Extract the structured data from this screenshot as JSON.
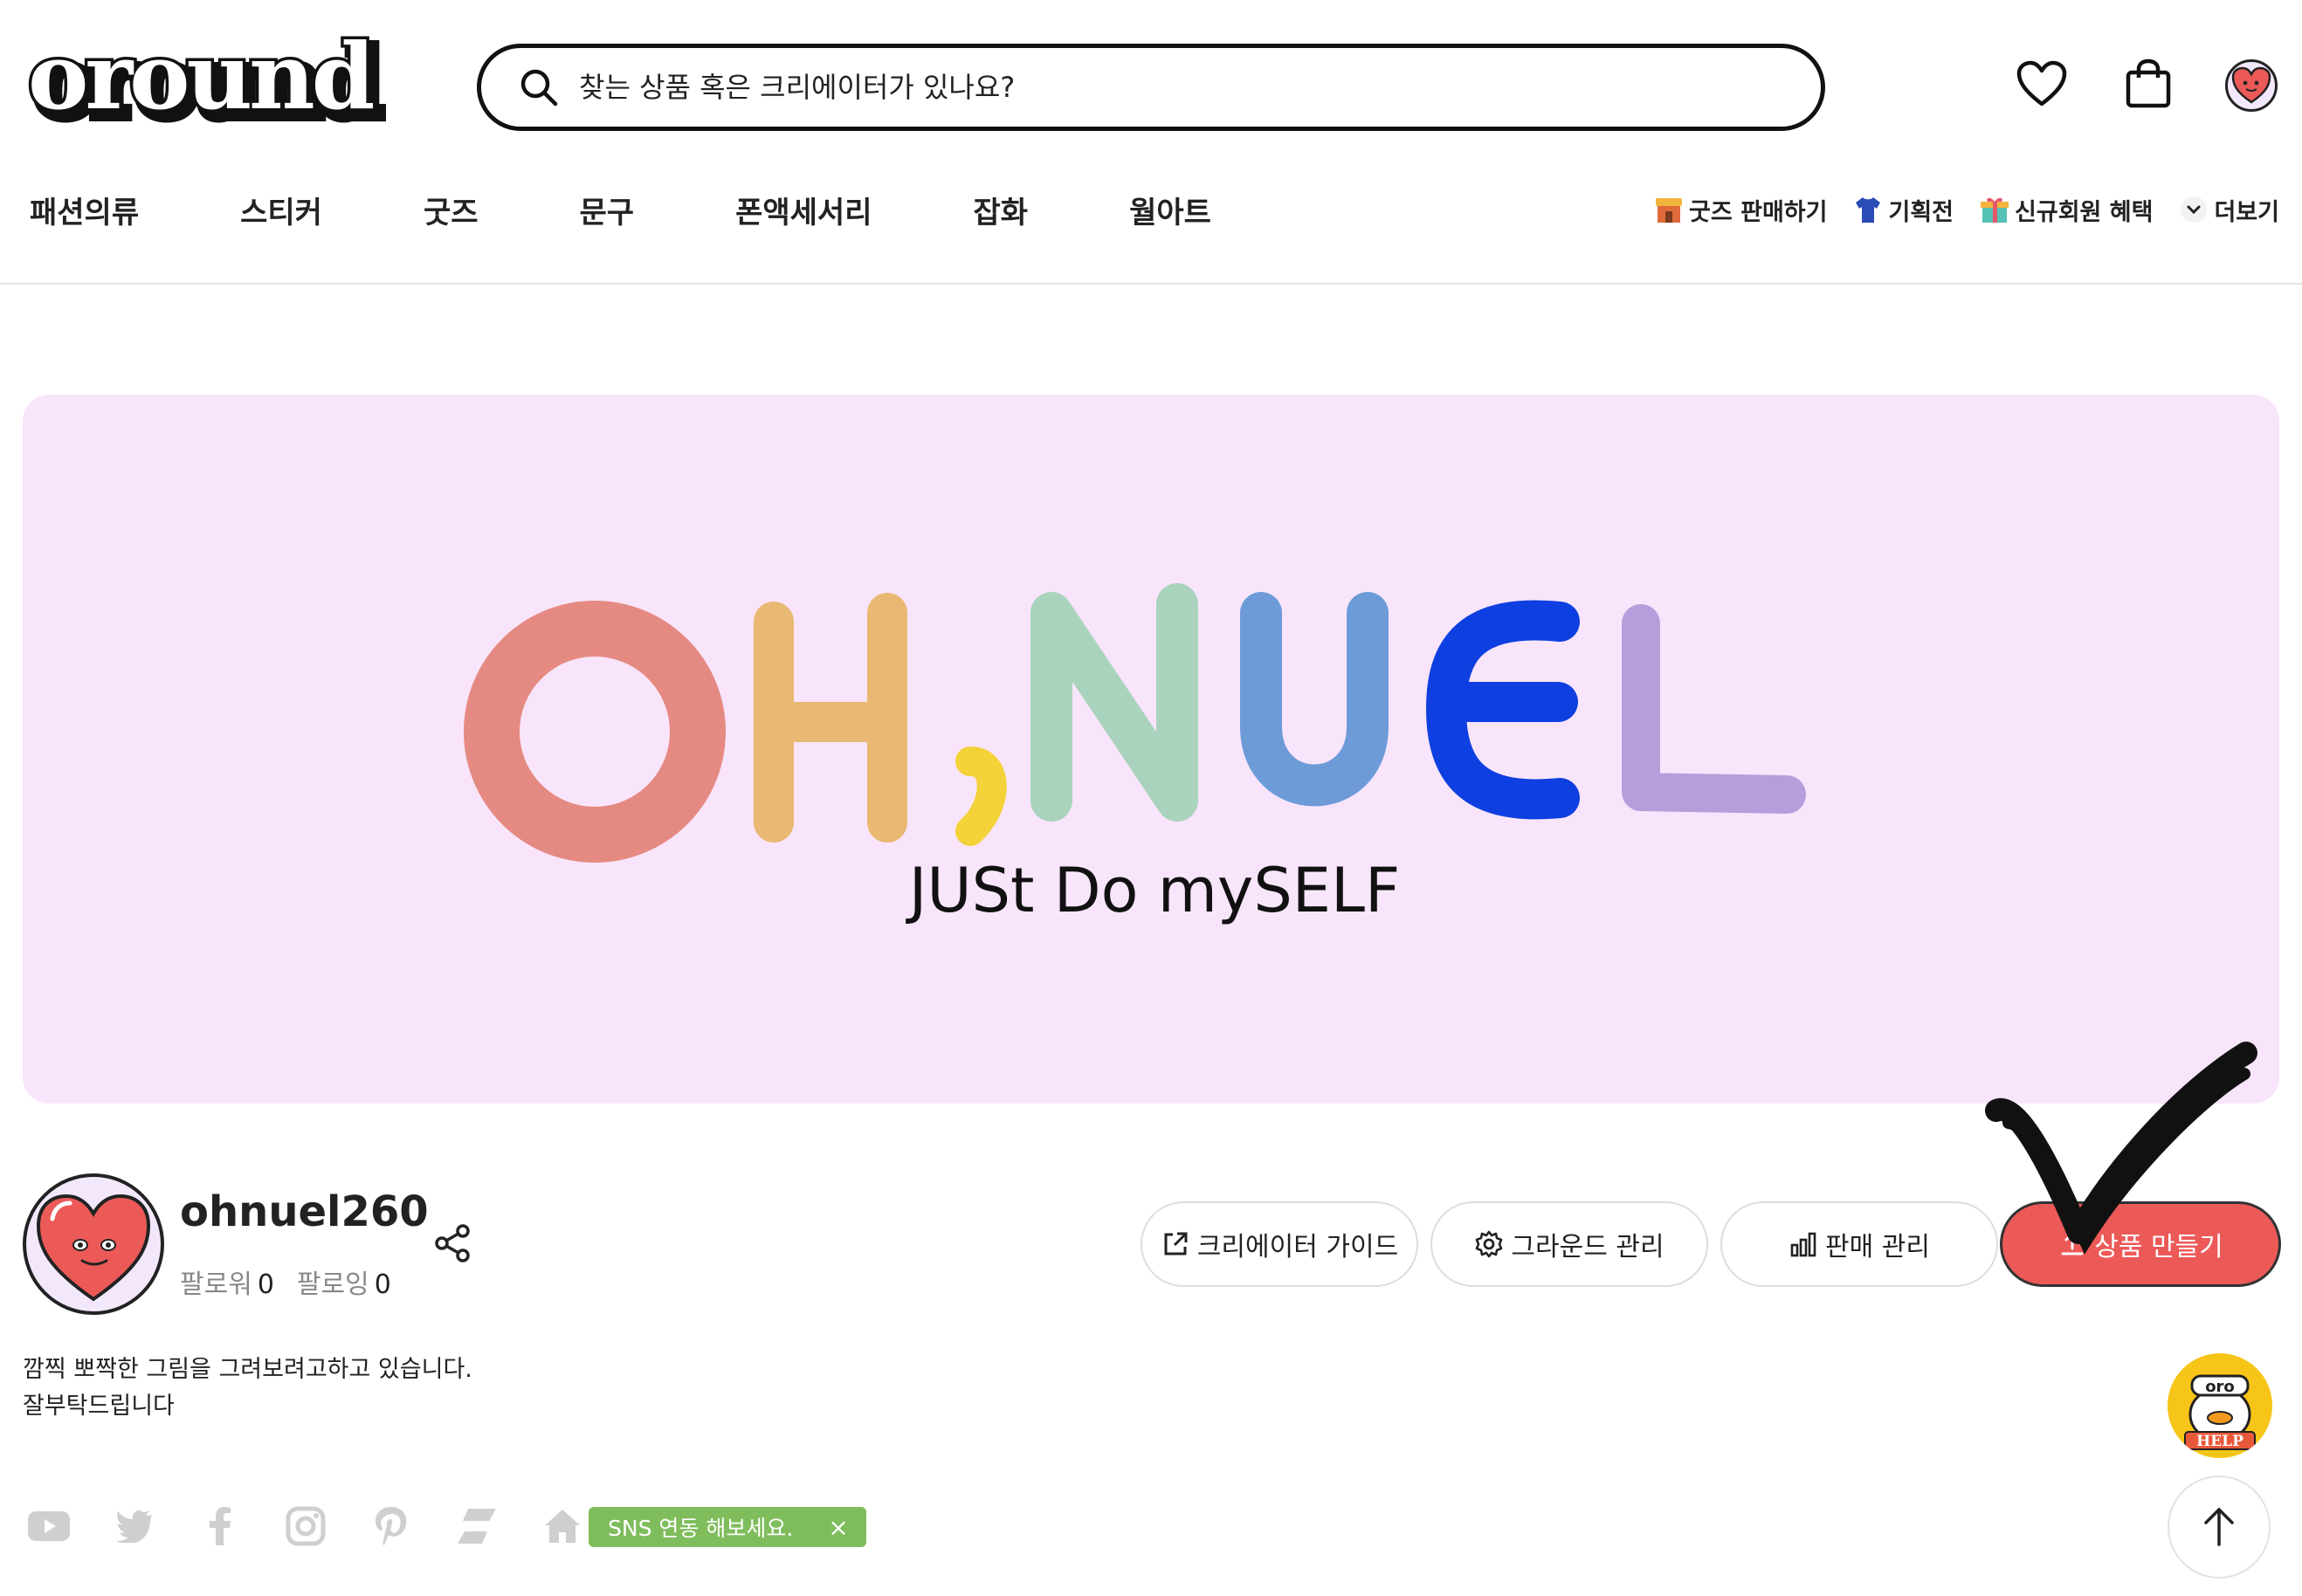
{
  "header": {
    "logo_text": "oround",
    "search": {
      "placeholder": "찾는 상품 혹은 크리에이터가 있나요?",
      "value": ""
    },
    "icons": [
      "heart-icon",
      "bag-icon",
      "profile-avatar"
    ]
  },
  "categories": [
    "패션의류",
    "스티커",
    "굿즈",
    "문구",
    "폰액세서리",
    "잡화",
    "월아트"
  ],
  "utility_nav": [
    {
      "label": "굿즈 판매하기",
      "icon": "shop-icon"
    },
    {
      "label": "기획전",
      "icon": "shirt-icon"
    },
    {
      "label": "신규회원 혜택",
      "icon": "gift-icon"
    },
    {
      "label": "더보기",
      "icon": "chevron-down-icon"
    }
  ],
  "banner": {
    "title_letters": [
      "O",
      "H",
      ",",
      "N",
      "U",
      "E",
      "L"
    ],
    "subtitle": "JUSt Do mySELF",
    "colors": {
      "background": "#f9e5fb",
      "O": "#e58a82",
      "H": "#e9b872",
      "comma": "#f3d23a",
      "N": "#a9d3bd",
      "U": "#6d9bd8",
      "E": "#0e3fe0",
      "L": "#b79ddc"
    }
  },
  "profile": {
    "username": "ohnuel260",
    "followers_label": "팔로워",
    "followers_count": "0",
    "following_label": "팔로잉",
    "following_count": "0",
    "bio_lines": [
      "깜찍 뽀짝한 그림을 그려보려고하고 있습니다.",
      "잘부탁드립니다"
    ]
  },
  "actions": {
    "creator_guide": "크리에이터 가이드",
    "ground_manage": "그라운드 관리",
    "sales_manage": "판매 관리",
    "create_product": "상품 만들기"
  },
  "sns": {
    "icons": [
      "youtube-icon",
      "twitter-icon",
      "facebook-icon",
      "instagram-icon",
      "pinterest-icon",
      "zeta-icon",
      "home-icon"
    ],
    "tooltip": "SNS 연동 해보세요.",
    "tooltip_close": "×"
  },
  "help_badge": {
    "top_text": "oro",
    "bottom_text": "HELP"
  },
  "colors": {
    "accent": "#ec5a58",
    "sns_tip": "#7fbd5c",
    "help": "#f7c518"
  }
}
